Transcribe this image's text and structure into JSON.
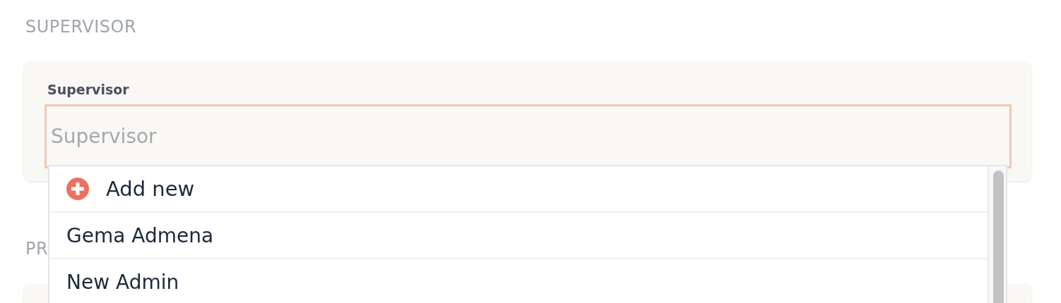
{
  "sections": [
    {
      "title": "SUPERVISOR",
      "field": {
        "label": "Supervisor",
        "placeholder": "Supervisor",
        "focused": true
      }
    },
    {
      "title": "PR"
    }
  ],
  "dropdown": {
    "items": [
      {
        "kind": "add",
        "label": "Add new"
      },
      {
        "kind": "option",
        "label": "Gema Admena"
      },
      {
        "kind": "option",
        "label": "New Admin"
      }
    ]
  }
}
